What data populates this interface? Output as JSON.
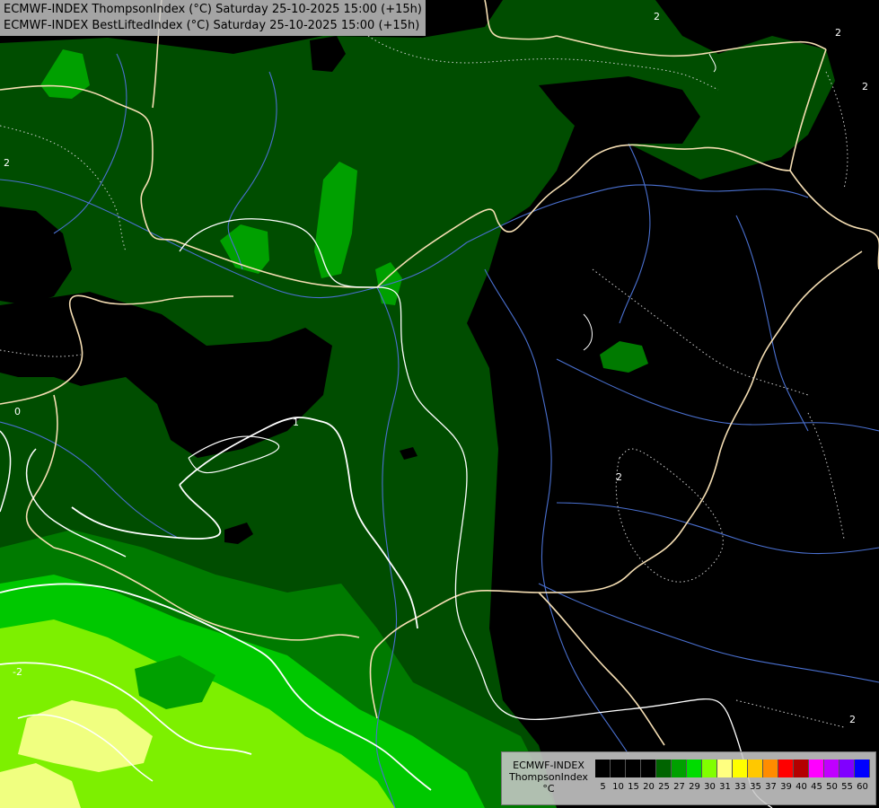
{
  "titles": [
    "ECMWF-INDEX ThompsonIndex (°C) Saturday 25-10-2025 15:00 (+15h)",
    "ECMWF-INDEX BestLiftedIndex (°C) Saturday 25-10-2025 15:00 (+15h)"
  ],
  "legend": {
    "line1": "ECMWF-INDEX",
    "line2": "ThompsonIndex",
    "line3": "°C",
    "ticks": [
      "5",
      "10",
      "15",
      "20",
      "25",
      "27",
      "29",
      "30",
      "31",
      "33",
      "35",
      "37",
      "39",
      "40",
      "45",
      "50",
      "55",
      "60"
    ],
    "colors": [
      "#000000",
      "#000000",
      "#000000",
      "#000000",
      "#006400",
      "#00a000",
      "#00dc00",
      "#80ff00",
      "#ffff80",
      "#ffff00",
      "#ffc800",
      "#ff8c00",
      "#ff0000",
      "#b40000",
      "#ff00ff",
      "#c000ff",
      "#8000ff",
      "#0000ff"
    ]
  },
  "contour_labels": [
    "2",
    "2",
    "2",
    "0",
    "1",
    "2",
    "-2",
    "2",
    "2"
  ],
  "colors": {
    "dark_green": "#004d00",
    "mid_green": "#007a00",
    "bright_green": "#00c800",
    "lime": "#7df000",
    "pale_yellow": "#f0ff80",
    "border": "#f5deb3",
    "river": "#4a70d0",
    "contour": "#ffffff"
  }
}
